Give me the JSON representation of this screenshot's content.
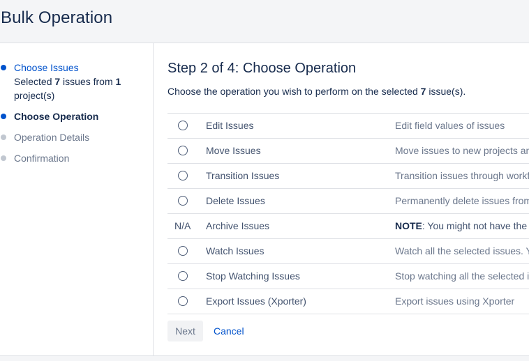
{
  "header": {
    "title": "Bulk Operation"
  },
  "steps": {
    "choose_issues": {
      "label": "Choose Issues",
      "detail_prefix": "Selected ",
      "issue_count": "7",
      "detail_middle": " issues from ",
      "project_count": "1",
      "detail_suffix": " project(s)"
    },
    "choose_operation": {
      "label": "Choose Operation"
    },
    "operation_details": {
      "label": "Operation Details"
    },
    "confirmation": {
      "label": "Confirmation"
    }
  },
  "main": {
    "title": "Step 2 of 4: Choose Operation",
    "subtitle_prefix": "Choose the operation you wish to perform on the selected ",
    "subtitle_count": "7",
    "subtitle_suffix": " issue(s).",
    "operations": [
      {
        "name": "Edit Issues",
        "description": "Edit field values of issues"
      },
      {
        "name": "Move Issues",
        "description": "Move issues to new projects and issue types"
      },
      {
        "name": "Transition Issues",
        "description": "Transition issues through workflow"
      },
      {
        "name": "Delete Issues",
        "description": "Permanently delete issues from Jira"
      },
      {
        "na_label": "N/A",
        "name": "Archive Issues",
        "note_label": "NOTE",
        "description": ": You might not have the permission to archive issues"
      },
      {
        "name": "Watch Issues",
        "description": "Watch all the selected issues. You will receive notifications"
      },
      {
        "name": "Stop Watching Issues",
        "description": "Stop watching all the selected issues"
      },
      {
        "name": "Export Issues (Xporter)",
        "description": "Export issues using Xporter"
      }
    ]
  },
  "actions": {
    "next_label": "Next",
    "cancel_label": "Cancel"
  },
  "colors": {
    "link": "#0052cc",
    "text": "#172b4d",
    "muted": "#6b778c",
    "border": "#dfe1e6",
    "header_bg": "#f4f5f7"
  }
}
